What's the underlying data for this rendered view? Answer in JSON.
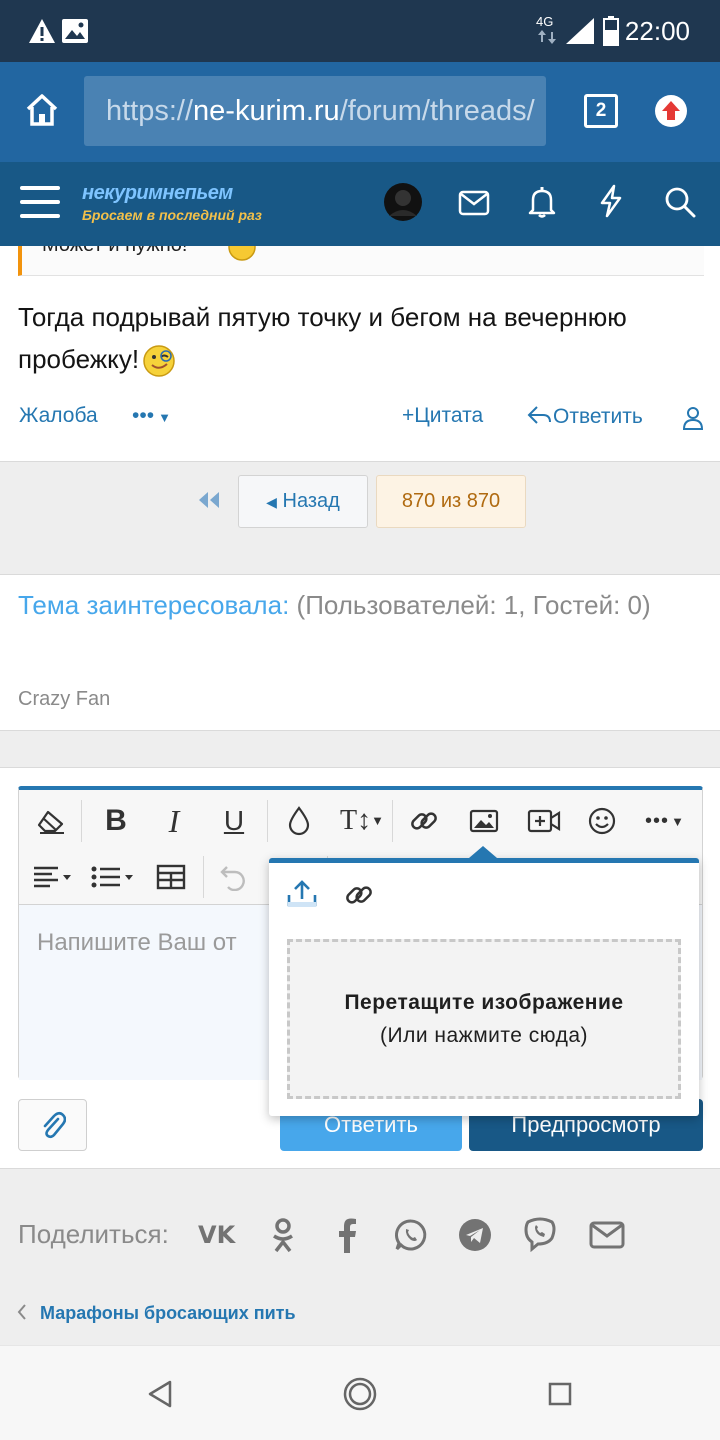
{
  "status_bar": {
    "time": "22:00",
    "network": "4G"
  },
  "browser": {
    "url_prefix": "https://",
    "url_domain": "ne-kurim.ru",
    "url_path": "/forum/threads/",
    "tab_count": "2"
  },
  "forum_header": {
    "logo_line1": "некуримнепьем",
    "logo_line2": "Бросаем в последний раз"
  },
  "post": {
    "quote_tail": "Может и нужно!",
    "text": "Тогда подрывай пятую точку и бегом на вечернюю пробежку!",
    "report_label": "Жалоба",
    "more_label": "•••",
    "quote_label": "Цитата",
    "reply_label": "Ответить"
  },
  "pagination": {
    "back_label": "Назад",
    "page_info": "870 из 870"
  },
  "interest": {
    "title": "Тема заинтересовала:",
    "counts": "(Пользователей: 1, Гостей: 0)",
    "user": "Crazy Fan"
  },
  "editor": {
    "placeholder": "Напишите Ваш от",
    "popup": {
      "drop_title": "Перетащите изображение",
      "drop_hint": "(Или нажмите сюда)"
    },
    "reply_button": "Ответить",
    "preview_button": "Предпросмотр"
  },
  "share": {
    "label": "Поделиться:"
  },
  "breadcrumb": {
    "label": "Марафоны бросающих пить"
  },
  "colors": {
    "accent": "#2577b1",
    "header": "#185886",
    "browser": "#2266a1",
    "status": "#1f3750"
  }
}
